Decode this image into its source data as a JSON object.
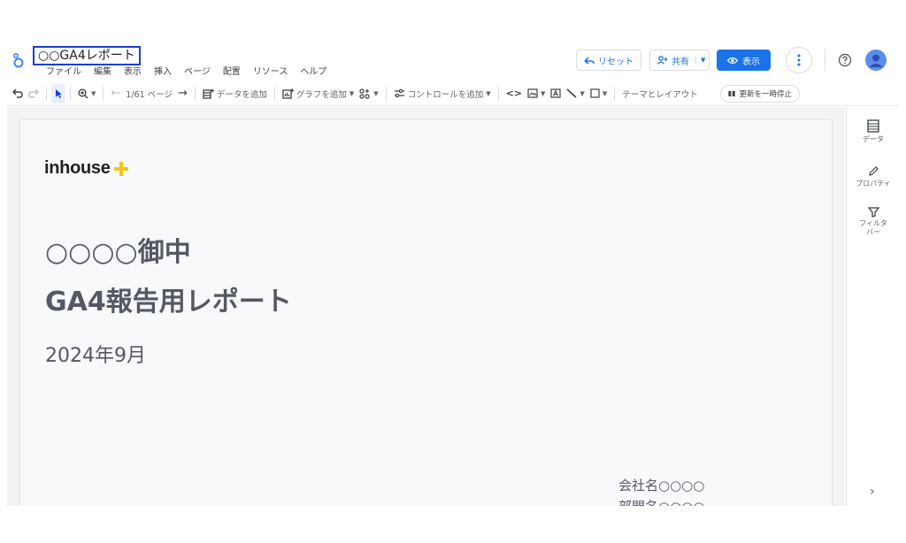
{
  "header": {
    "doc_title": "○○GA4レポート",
    "menu": [
      "ファイル",
      "編集",
      "表示",
      "挿入",
      "ページ",
      "配置",
      "リソース",
      "ヘルプ"
    ],
    "reset_label": "リセット",
    "share_label": "共有",
    "view_label": "表示"
  },
  "toolbar": {
    "page_indicator": "1/61 ページ",
    "add_data": "データを追加",
    "add_chart": "グラフを追加",
    "add_control": "コントロールを追加",
    "theme_layout": "テーマとレイアウト",
    "pause_updates": "更新を一時停止"
  },
  "page": {
    "brand": "inhouse",
    "title_line1": "○○○○御中",
    "title_line2": "GA4報告用レポート",
    "date": "2024年9月",
    "company": "会社名○○○○",
    "dept": "部門名○○○○"
  },
  "side_panel": {
    "items": [
      {
        "label": "データ",
        "icon": "table-icon"
      },
      {
        "label": "プロパティ",
        "icon": "pencil-icon"
      },
      {
        "label": "フィルタバー",
        "icon": "filter-icon"
      }
    ]
  },
  "colors": {
    "accent": "#1a73e8",
    "brand_plus": "#f7c416",
    "title_text": "#555864"
  }
}
